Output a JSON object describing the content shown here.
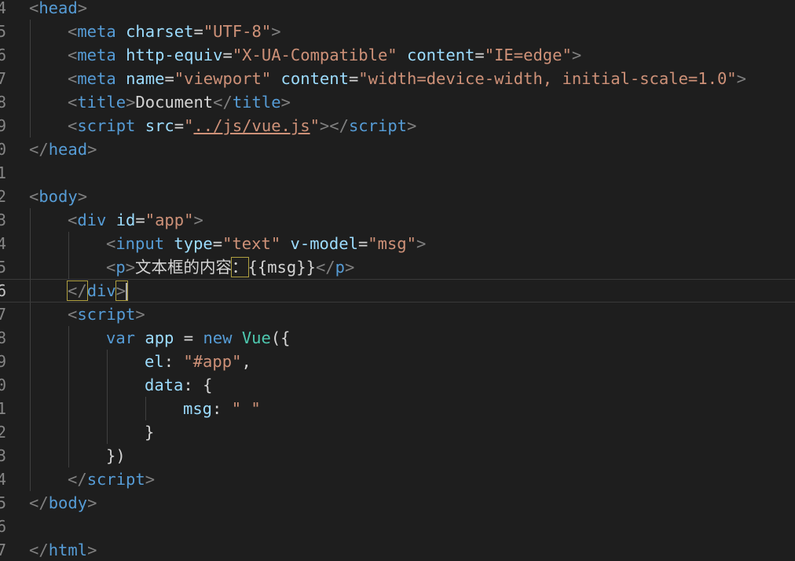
{
  "editor": {
    "gutter_numbers": [
      "4",
      "5",
      "6",
      "7",
      "8",
      "9",
      "0",
      "1",
      "2",
      "3",
      "4",
      "5",
      "6",
      "7",
      "8",
      "9",
      "0",
      "1",
      "2",
      "3",
      "4",
      "5",
      "6",
      "7"
    ],
    "active_line_number": "6"
  },
  "code": {
    "l1": {
      "open": "<",
      "tag": "head",
      "close": ">"
    },
    "l2": {
      "open": "<",
      "tag": "meta",
      "a1": "charset",
      "eq": "=",
      "v1": "\"UTF-8\"",
      "close": ">"
    },
    "l3": {
      "open": "<",
      "tag": "meta",
      "a1": "http-equiv",
      "eq1": "=",
      "v1": "\"X-UA-Compatible\"",
      "a2": "content",
      "eq2": "=",
      "v2": "\"IE=edge\"",
      "close": ">"
    },
    "l4": {
      "open": "<",
      "tag": "meta",
      "a1": "name",
      "eq1": "=",
      "v1": "\"viewport\"",
      "a2": "content",
      "eq2": "=",
      "v2": "\"width=device-width, initial-scale=1.0\"",
      "close": ">"
    },
    "l5": {
      "open": "<",
      "tag": "title",
      "close": ">",
      "text": "Document",
      "open2": "</",
      "tag2": "title",
      "close2": ">"
    },
    "l6": {
      "open": "<",
      "tag": "script",
      "a1": "src",
      "eq": "=",
      "q1": "\"",
      "v1": "../js/vue.js",
      "q2": "\"",
      "close": ">",
      "open2": "</",
      "tag2": "script",
      "close2": ">"
    },
    "l7": {
      "open": "</",
      "tag": "head",
      "close": ">"
    },
    "l9": {
      "open": "<",
      "tag": "body",
      "close": ">"
    },
    "l10": {
      "open": "<",
      "tag": "div",
      "a1": "id",
      "eq": "=",
      "v1": "\"app\"",
      "close": ">"
    },
    "l11": {
      "open": "<",
      "tag": "input",
      "a1": "type",
      "eq1": "=",
      "v1": "\"text\"",
      "a2": "v-model",
      "eq2": "=",
      "v2": "\"msg\"",
      "close": ">"
    },
    "l12": {
      "open": "<",
      "tag": "p",
      "close": ">",
      "text1": "文本框的内容",
      "colon": "：",
      "text2": "{{msg}}",
      "open2": "</",
      "tag2": "p",
      "close2": ">"
    },
    "l13": {
      "open": "</",
      "tag": "div",
      "close": ">"
    },
    "l14": {
      "open": "<",
      "tag": "script",
      "close": ">"
    },
    "l15": {
      "kw1": "var",
      "id1": "app",
      "op": "=",
      "kw2": "new",
      "cls": "Vue",
      "paren": "({"
    },
    "l16": {
      "key": "el",
      "colon": ":",
      "v": "\"#app\"",
      "comma": ","
    },
    "l17": {
      "key": "data",
      "colon": ":",
      "brace": "{"
    },
    "l18": {
      "key": "msg",
      "colon": ":",
      "v": "\" \""
    },
    "l19": {
      "brace": "}"
    },
    "l20": {
      "close": "})"
    },
    "l21": {
      "open": "</",
      "tag": "script",
      "close": ">"
    },
    "l22": {
      "open": "</",
      "tag": "body",
      "close": ">"
    },
    "l24": {
      "open": "</",
      "tag": "html",
      "close": ">"
    }
  }
}
